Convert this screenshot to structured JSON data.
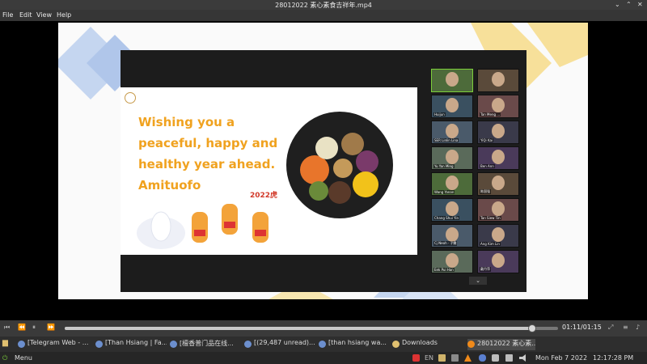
{
  "window": {
    "title": "28012022 素心素食吉祥年.mp4",
    "controls": {
      "minimize": "⌄",
      "maximize": "⌃",
      "close": "✕"
    }
  },
  "menu": {
    "file": "File",
    "edit": "Edit",
    "view": "View",
    "help": "Help"
  },
  "video": {
    "greeting": "Wishing you a\npeaceful, happy and\nhealthy year ahead.\nAmituofo",
    "year_badge": "2022虎",
    "participants": [
      "",
      "",
      "Huijun",
      "Tan Meng ...",
      "SER Linlin Lina",
      "YiQi Kai",
      "Yu Yan Ming",
      "Ben Ann",
      "Wang Yanan",
      "陈国强",
      "Chang Shui Yin",
      "Tan Siew Tin",
      "Cj Neoh · 子霖",
      "Ang Kim Lin",
      "Eek Pui Han",
      "戴丹萍"
    ],
    "tiles_scroll": "⌄"
  },
  "player": {
    "time": "01:11/01:15",
    "progress": 0.947,
    "buttons": {
      "skip_back": "⏮",
      "rewind": "⏪",
      "pause": "⏸",
      "forward": "⏩",
      "skip_fwd": "⏭"
    }
  },
  "taskbar": {
    "tasks": [
      "[Telegram Web - ...",
      "[Than Hsiang | Fa...",
      "[檀香普门品在线...",
      "[(29,487 unread)...",
      "[than hsiang wa...",
      "Downloads",
      "28012022 素心素..."
    ],
    "menu_label": "Menu",
    "lang": "EN",
    "clock_date": "Mon Feb  7 2022",
    "clock_time": "12:17:28 PM"
  }
}
